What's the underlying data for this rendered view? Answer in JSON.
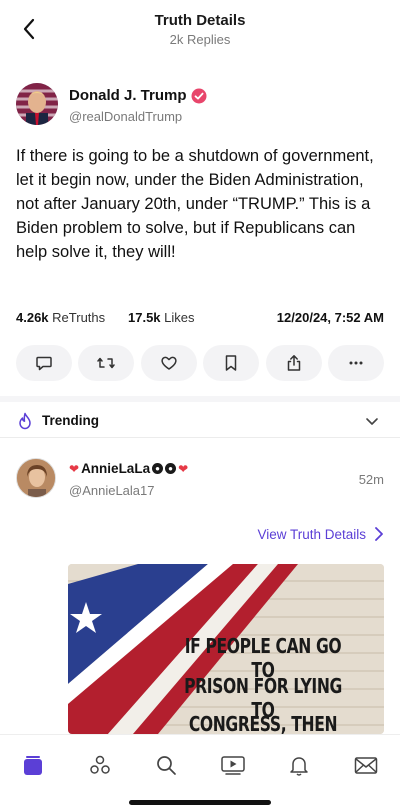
{
  "header": {
    "title": "Truth Details",
    "subtitle": "2k Replies"
  },
  "post": {
    "author_name": "Donald J. Trump",
    "author_handle": "@realDonaldTrump",
    "text": "If there is going to be a shutdown of government, let it begin now, under the Biden Administration, not after January 20th, under “TRUMP.” This is a Biden problem to solve, but if Republicans can help solve it, they will!",
    "retruths_count": "4.26k",
    "retruths_label": "ReTruths",
    "likes_count": "17.5k",
    "likes_label": "Likes",
    "timestamp": "12/20/24, 7:52 AM"
  },
  "actions": [
    {
      "icon": "reply-icon"
    },
    {
      "icon": "retruth-icon"
    },
    {
      "icon": "like-icon"
    },
    {
      "icon": "bookmark-icon"
    },
    {
      "icon": "share-icon"
    },
    {
      "icon": "more-icon"
    }
  ],
  "trending": {
    "label": "Trending"
  },
  "reply": {
    "author_name": "AnnieLaLa",
    "author_handle": "@AnnieLala17",
    "time": "52m",
    "view_details": "View Truth Details",
    "image_text": [
      "IF PEOPLE CAN GO TO",
      "PRISON FOR LYING TO",
      "CONGRESS, THEN"
    ]
  },
  "colors": {
    "accent": "#5b3fd6",
    "verified": "#e8456b",
    "text_muted": "#7a7a7a"
  },
  "nav": [
    "home-icon",
    "groups-icon",
    "search-icon",
    "video-icon",
    "notifications-icon",
    "messages-icon"
  ]
}
